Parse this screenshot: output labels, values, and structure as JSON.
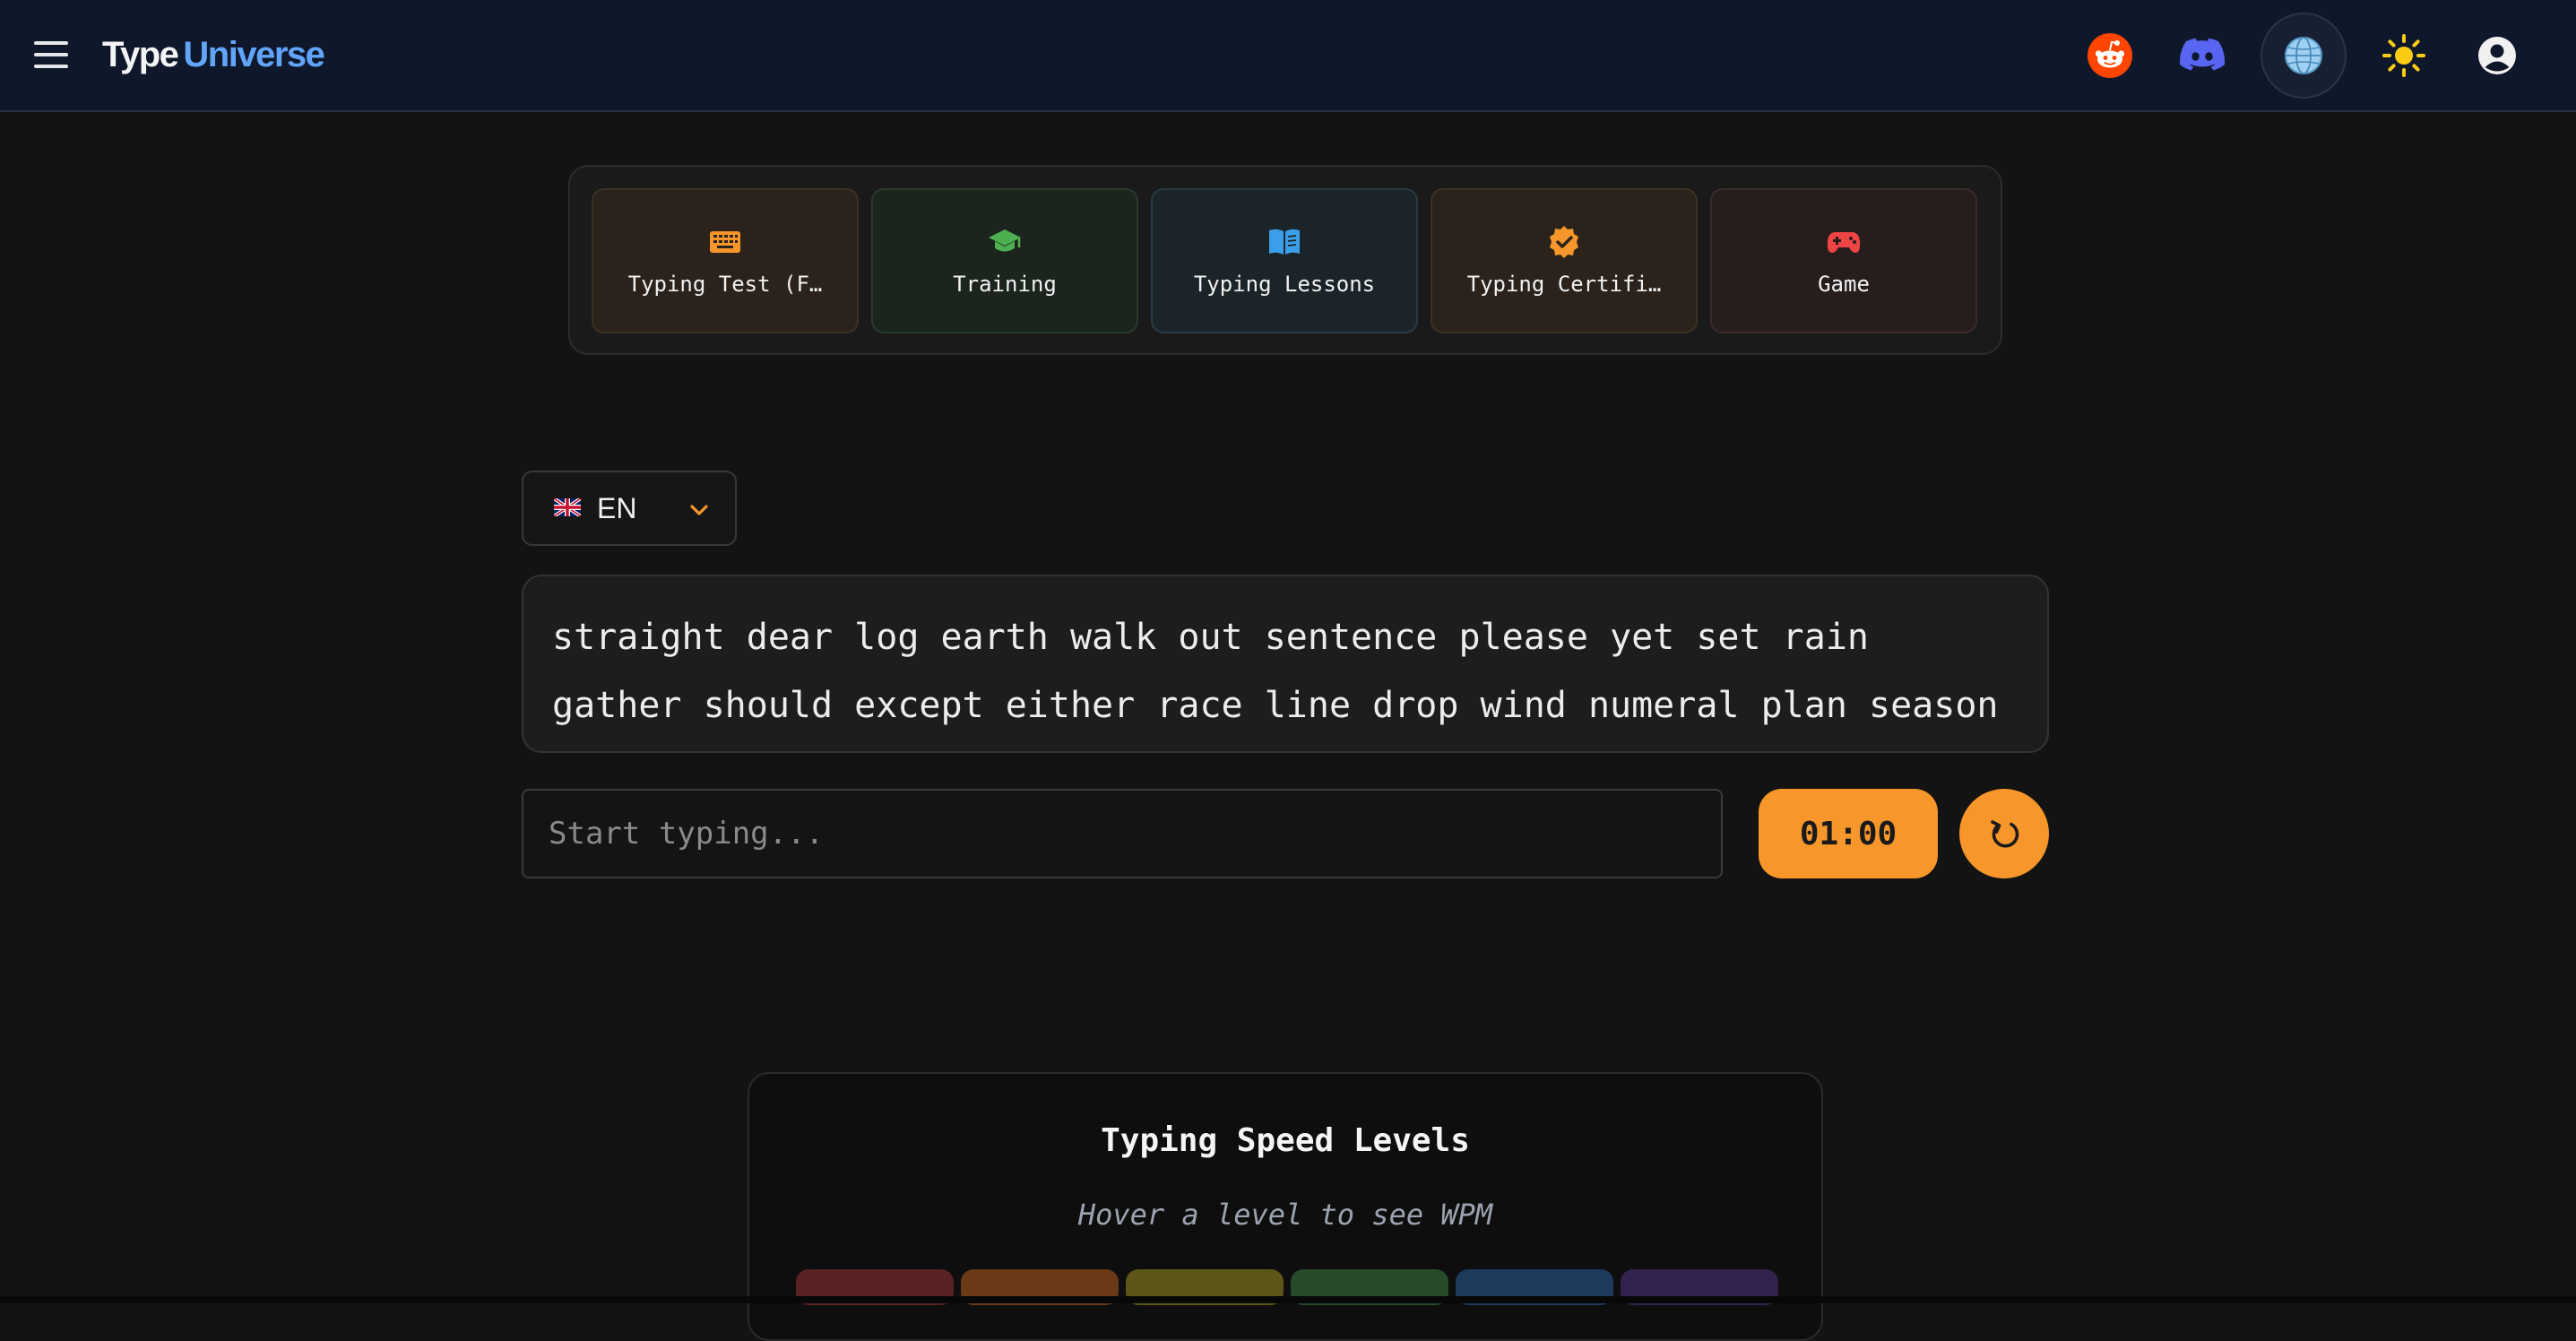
{
  "header": {
    "logo_part1": "Type",
    "logo_part2": "Universe",
    "icons": [
      "menu-icon",
      "reddit-icon",
      "discord-icon",
      "globe-icon",
      "sun-icon",
      "user-icon"
    ]
  },
  "tabs": [
    {
      "label": "Typing Test (F…",
      "icon": "keyboard-icon",
      "color": "#f7962a"
    },
    {
      "label": "Training",
      "icon": "graduation-cap-icon",
      "color": "#4caf50"
    },
    {
      "label": "Typing Lessons",
      "icon": "book-icon",
      "color": "#3b9eea"
    },
    {
      "label": "Typing Certifi…",
      "icon": "certificate-icon",
      "color": "#f7962a"
    },
    {
      "label": "Game",
      "icon": "gamepad-icon",
      "color": "#ef4444"
    }
  ],
  "language": {
    "code": "EN",
    "flag": "uk-flag-icon"
  },
  "words": {
    "line1": "straight dear log earth walk out sentence please yet set rain",
    "line2": "gather should except either race line drop wind numeral plan season"
  },
  "input": {
    "placeholder": "Start typing...",
    "value": ""
  },
  "timer": "01:00",
  "levels": {
    "title": "Typing Speed Levels",
    "hint": "Hover a level to see WPM",
    "bar_colors": [
      "#5a2222",
      "#6a3a16",
      "#5c5618",
      "#274a2a",
      "#1e3a5c",
      "#33224d"
    ]
  },
  "colors": {
    "accent": "#f7962a",
    "header_bg": "#0f172a",
    "logo_accent": "#60a5fa"
  }
}
